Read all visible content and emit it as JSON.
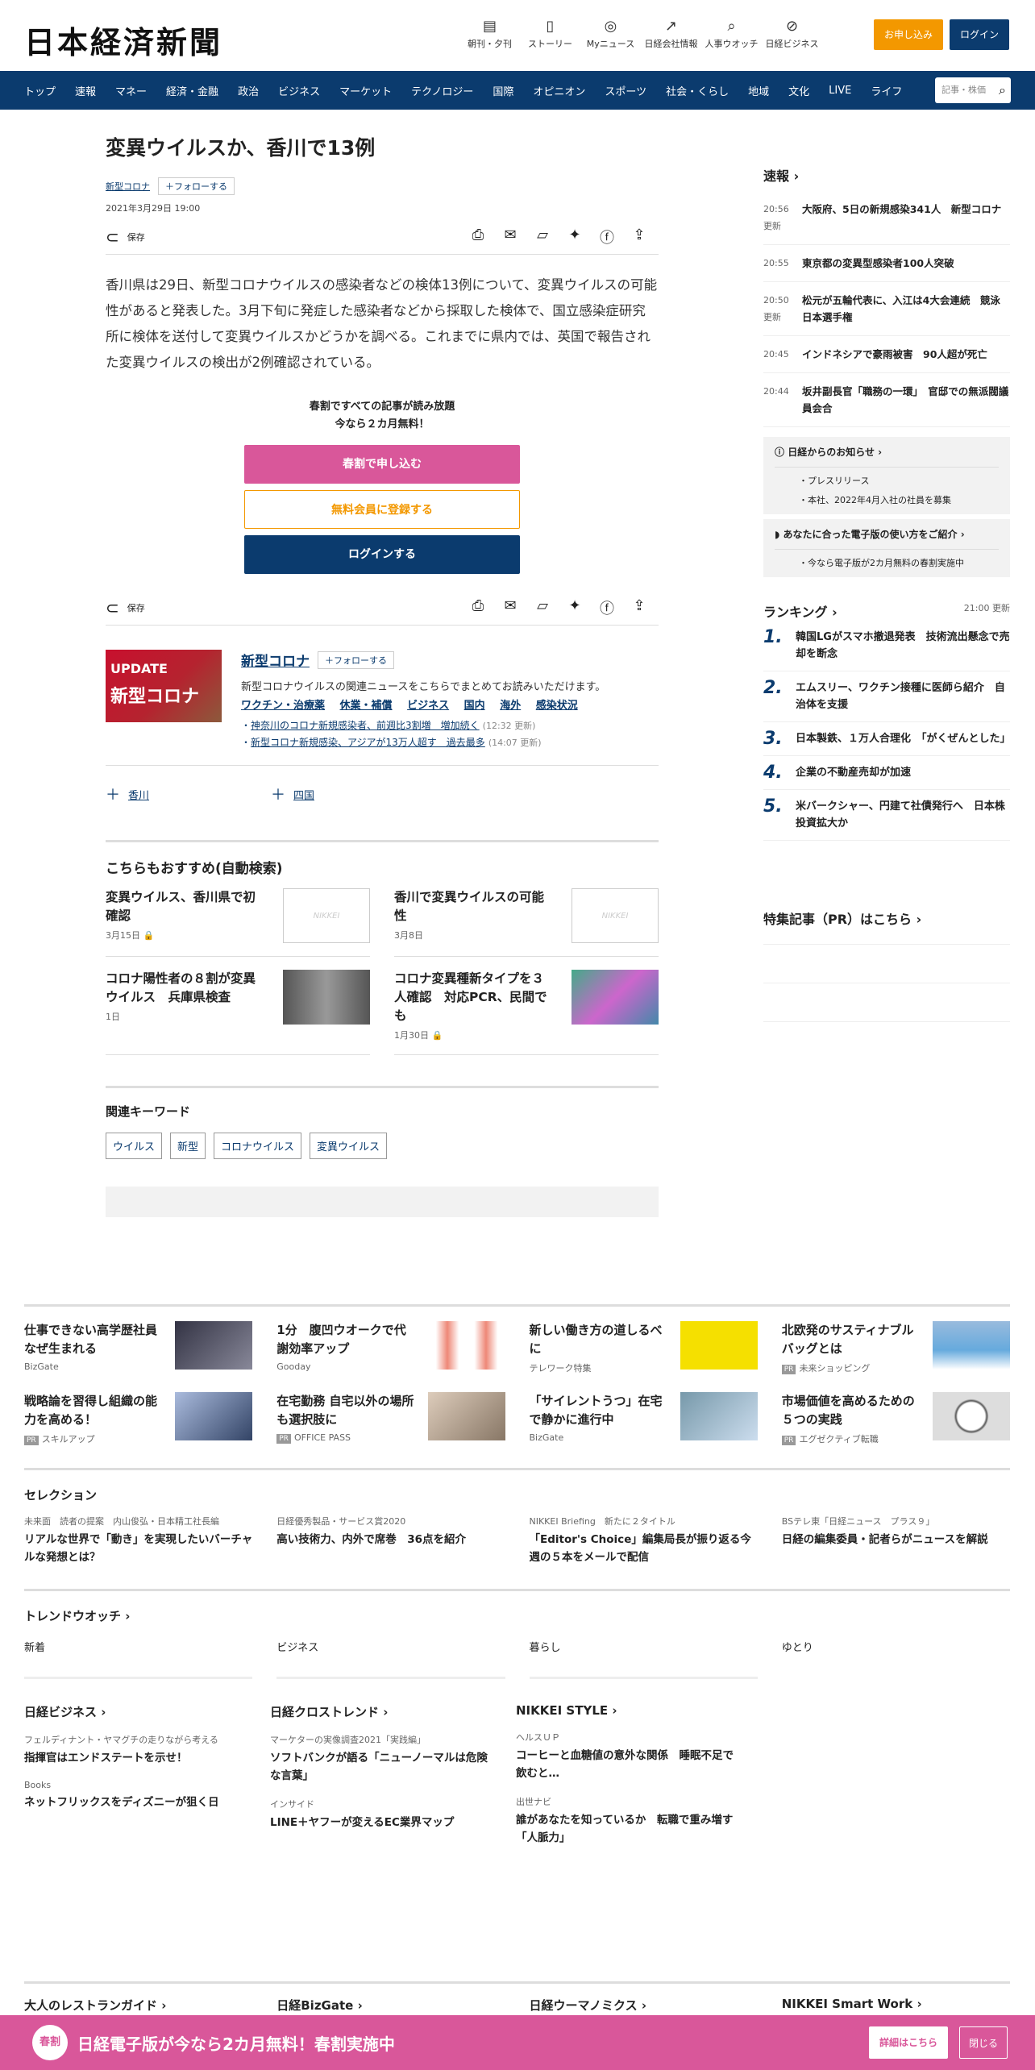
{
  "header": {
    "logo": "日本経済新聞",
    "icons": [
      {
        "label": "朝刊・夕刊",
        "icon": "newspaper-icon"
      },
      {
        "label": "ストーリー",
        "icon": "document-icon"
      },
      {
        "label": "Myニュース",
        "icon": "user-icon"
      },
      {
        "label": "日経会社情報",
        "icon": "chart-icon"
      },
      {
        "label": "人事ウオッチ",
        "icon": "search-icon"
      },
      {
        "label": "日経ビジネス",
        "icon": "compass-icon"
      }
    ],
    "apply": "お申し込み",
    "login": "ログイン"
  },
  "nav": {
    "items": [
      "トップ",
      "速報",
      "マネー",
      "経済・金融",
      "政治",
      "ビジネス",
      "マーケット",
      "テクノロジー",
      "国際",
      "オピニオン",
      "スポーツ",
      "社会・くらし",
      "地域",
      "文化",
      "LIVE",
      "ライフ"
    ],
    "search_placeholder": "記事・株価"
  },
  "article": {
    "title": "変異ウイルスか、香川で13例",
    "topic": "新型コロナ",
    "follow": "フォローする",
    "date": "2021年3月29日 19:00",
    "save": "保存",
    "body": "香川県は29日、新型コロナウイルスの感染者などの検体13例について、変異ウイルスの可能性があると発表した。3月下旬に発症した感染者などから採取した検体で、国立感染症研究所に検体を送付して変異ウイルスかどうかを調べる。これまでに県内では、英国で報告された変異ウイルスの検出が2例確認されている。",
    "promo_line1": "春割ですべての記事が読み放題",
    "promo_line2": "今なら２カ月無料！",
    "btn_spring": "春割で申し込む",
    "btn_free": "無料会員に登録する",
    "btn_login": "ログインする"
  },
  "topicbox": {
    "img_line1": "UPDATE",
    "img_line2": "新型コロナ",
    "title": "新型コロナ",
    "follow": "フォローする",
    "desc": "新型コロナウイルスの関連ニュースをこちらでまとめてお読みいただけます。",
    "links": [
      "ワクチン・治療薬",
      "休業・補償",
      "ビジネス",
      "国内",
      "海外",
      "感染状況"
    ],
    "rel": [
      {
        "text": "神奈川のコロナ新規感染者、前週比3割増　増加続く",
        "meta": "(12:32 更新)"
      },
      {
        "text": "新型コロナ新規感染、アジアが13万人超す　過去最多",
        "meta": "(14:07 更新)"
      }
    ]
  },
  "tags": [
    "香川",
    "四国"
  ],
  "recommend": {
    "title": "こちらもおすすめ(自動検索)",
    "items": [
      {
        "title": "変異ウイルス、香川県で初確認",
        "date": "3月15日",
        "img": "NIKKEI"
      },
      {
        "title": "香川で変異ウイルスの可能性",
        "date": "3月8日",
        "img": "NIKKEI"
      },
      {
        "title": "コロナ陽性者の８割が変異ウイルス　兵庫県検査",
        "date": "1日",
        "img": ""
      },
      {
        "title": "コロナ変異種新タイプを３人確認　対応PCR、民間でも",
        "date": "1月30日",
        "img": ""
      }
    ]
  },
  "keywords": {
    "title": "関連キーワード",
    "items": [
      "ウイルス",
      "新型",
      "コロナウイルス",
      "変異ウイルス"
    ]
  },
  "sidebar": {
    "flash_title": "速報",
    "flash": [
      {
        "time": "20:56",
        "upd": "更新",
        "text": "大阪府、5日の新規感染341人　新型コロナ"
      },
      {
        "time": "20:55",
        "upd": "",
        "text": "東京都の変異型感染者100人突破"
      },
      {
        "time": "20:50",
        "upd": "更新",
        "text": "松元が五輪代表に、入江は4大会連続　競泳日本選手権"
      },
      {
        "time": "20:45",
        "upd": "",
        "text": "インドネシアで豪雨被害　90人超が死亡"
      },
      {
        "time": "20:44",
        "upd": "",
        "text": "坂井副長官「職務の一環」　官邸での無派閥議員会合"
      }
    ],
    "notice1_title": "日経からのお知らせ",
    "notice1_items": [
      "プレスリリース",
      "本社、2022年4月入社の社員を募集"
    ],
    "notice2_title": "あなたに合った電子版の使い方をご紹介",
    "notice2_items": [
      "今なら電子版が2カ月無料の春割実施中"
    ],
    "ranking_title": "ランキング",
    "ranking_update": "21:00  更新",
    "ranking": [
      {
        "n": "1.",
        "text": "韓国LGがスマホ撤退発表　技術流出懸念で売却を断念"
      },
      {
        "n": "2.",
        "text": "エムスリー、ワクチン接種に医師ら紹介　自治体を支援"
      },
      {
        "n": "3.",
        "text": "日本製鉄、１万人合理化　「がくぜんとした」"
      },
      {
        "n": "4.",
        "text": "企業の不動産売却が加速"
      },
      {
        "n": "5.",
        "text": "米バークシャー、円建て社債発行へ　日本株投資拡大か"
      }
    ],
    "pr_title": "特集記事（PR）はこちら"
  },
  "ads": [
    {
      "title": "仕事できない高学歴社員なぜ生まれる",
      "src": "BizGate",
      "pr": false
    },
    {
      "title": "1分　腹凹ウオークで代謝効率アップ",
      "src": "Gooday",
      "pr": false
    },
    {
      "title": "新しい働き方の道しるべに",
      "src": "テレワーク特集",
      "pr": false
    },
    {
      "title": "北欧発のサスティナブルバッグとは",
      "src": "未来ショッピング",
      "pr": true
    },
    {
      "title": "戦略論を習得し組織の能力を高める！",
      "src": "スキルアップ",
      "pr": true
    },
    {
      "title": "在宅勤務 自宅以外の場所も選択肢に",
      "src": "OFFICE PASS",
      "pr": true
    },
    {
      "title": "「サイレントうつ」在宅で静かに進行中",
      "src": "BizGate",
      "pr": false
    },
    {
      "title": "市場価値を高めるための５つの実践",
      "src": "エグゼクティブ転職",
      "pr": true
    }
  ],
  "selection": {
    "title": "セレクション",
    "items": [
      {
        "meta": "未来面　読者の提案　内山俊弘・日本精工社長編",
        "title": "リアルな世界で「動き」を実現したいバーチャルな発想とは？"
      },
      {
        "meta": "日経優秀製品・サービス賞2020",
        "title": "高い技術力、内外で席巻　36点を紹介"
      },
      {
        "meta": "NIKKEI Briefing　新たに２タイトル",
        "title": "「Editor's Choice」編集局長が振り返る今週の５本をメールで配信"
      },
      {
        "meta": "BSテレ東「日経ニュース　プラス９」",
        "title": "日経の編集委員・記者らがニュースを解説"
      }
    ]
  },
  "trend": {
    "title": "トレンドウオッチ",
    "cats": [
      "新着",
      "ビジネス",
      "暮らし",
      "ゆとり"
    ]
  },
  "media": [
    {
      "title": "日経ビジネス",
      "items": [
        {
          "meta": "フェルディナント・ヤマグチの走りながら考える",
          "title": "指揮官はエンドステートを示せ！"
        },
        {
          "meta": "Books",
          "title": "ネットフリックスをディズニーが狙く日"
        }
      ]
    },
    {
      "title": "日経クロストレンド",
      "items": [
        {
          "meta": "マーケターの実像調査2021「実践編」",
          "title": "ソフトバンクが語る「ニューノーマルは危険な言葉」"
        },
        {
          "meta": "インサイド",
          "title": "LINE＋ヤフーが変えるEC業界マップ"
        }
      ]
    },
    {
      "title": "NIKKEI STYLE",
      "items": [
        {
          "meta": "ヘルスＵＰ",
          "title": "コーヒーと血糖値の意外な関係　睡眠不足で飲むと…"
        },
        {
          "meta": "出世ナビ",
          "title": "誰があなたを知っているか　転職で重み増す「人脈力」"
        }
      ]
    }
  ],
  "bottom_links": [
    "大人のレストランガイド",
    "日経BizGate",
    "日経ウーマノミクス",
    "NIKKEI Smart Work"
  ],
  "banner": {
    "badge": "春割",
    "text": "日経電子版が今なら2カ月無料！春割実施中",
    "details": "詳細はこちら",
    "close": "閉じる"
  },
  "colors": {
    "navy": "#0b3b6e",
    "orange": "#f39800",
    "pink": "#d9579a"
  }
}
